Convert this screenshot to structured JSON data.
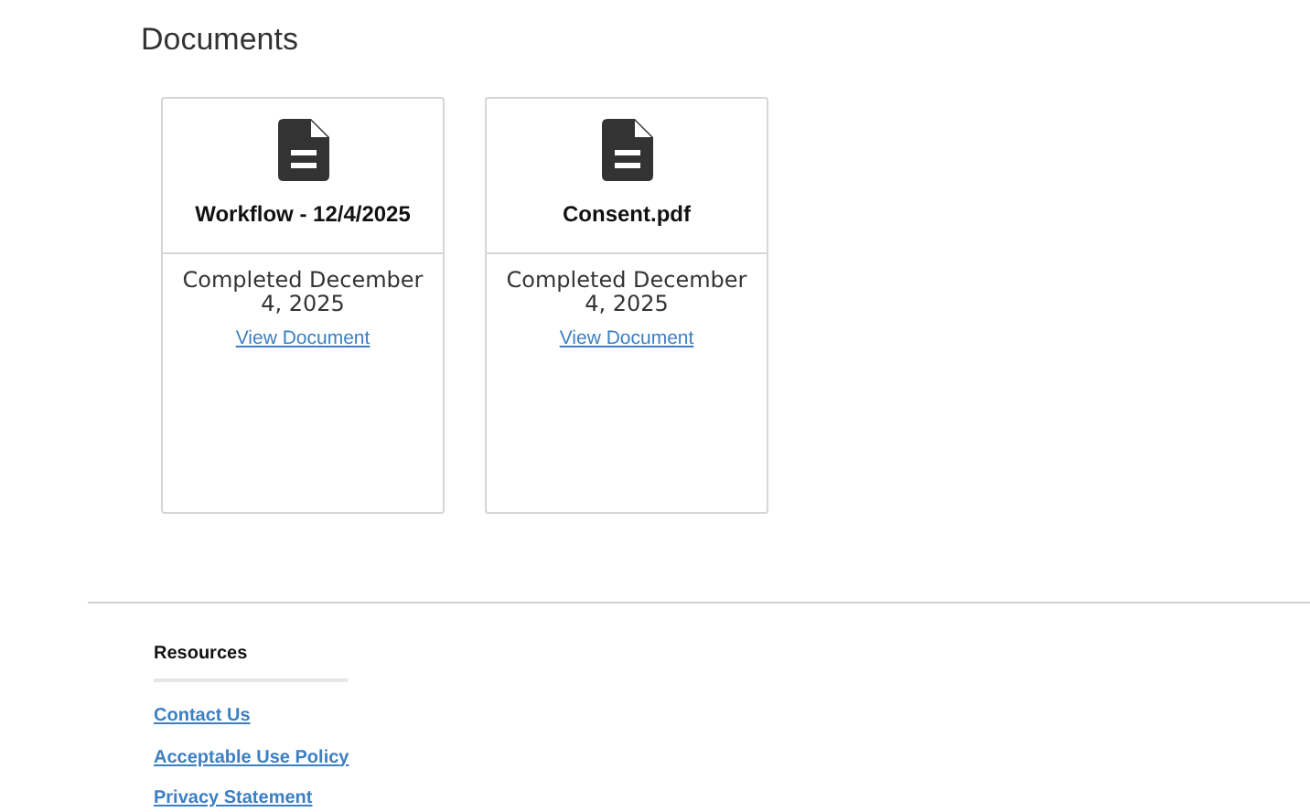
{
  "section": {
    "title": "Documents"
  },
  "documents": [
    {
      "name": "Workflow - 12/4/2025",
      "status": "Completed December 4, 2025",
      "link": "View Document"
    },
    {
      "name": "Consent.pdf",
      "status": "Completed December 4, 2025",
      "link": "View Document"
    }
  ],
  "footer": {
    "heading": "Resources",
    "links": [
      "Contact Us",
      "Acceptable Use Policy",
      "Privacy Statement"
    ]
  }
}
